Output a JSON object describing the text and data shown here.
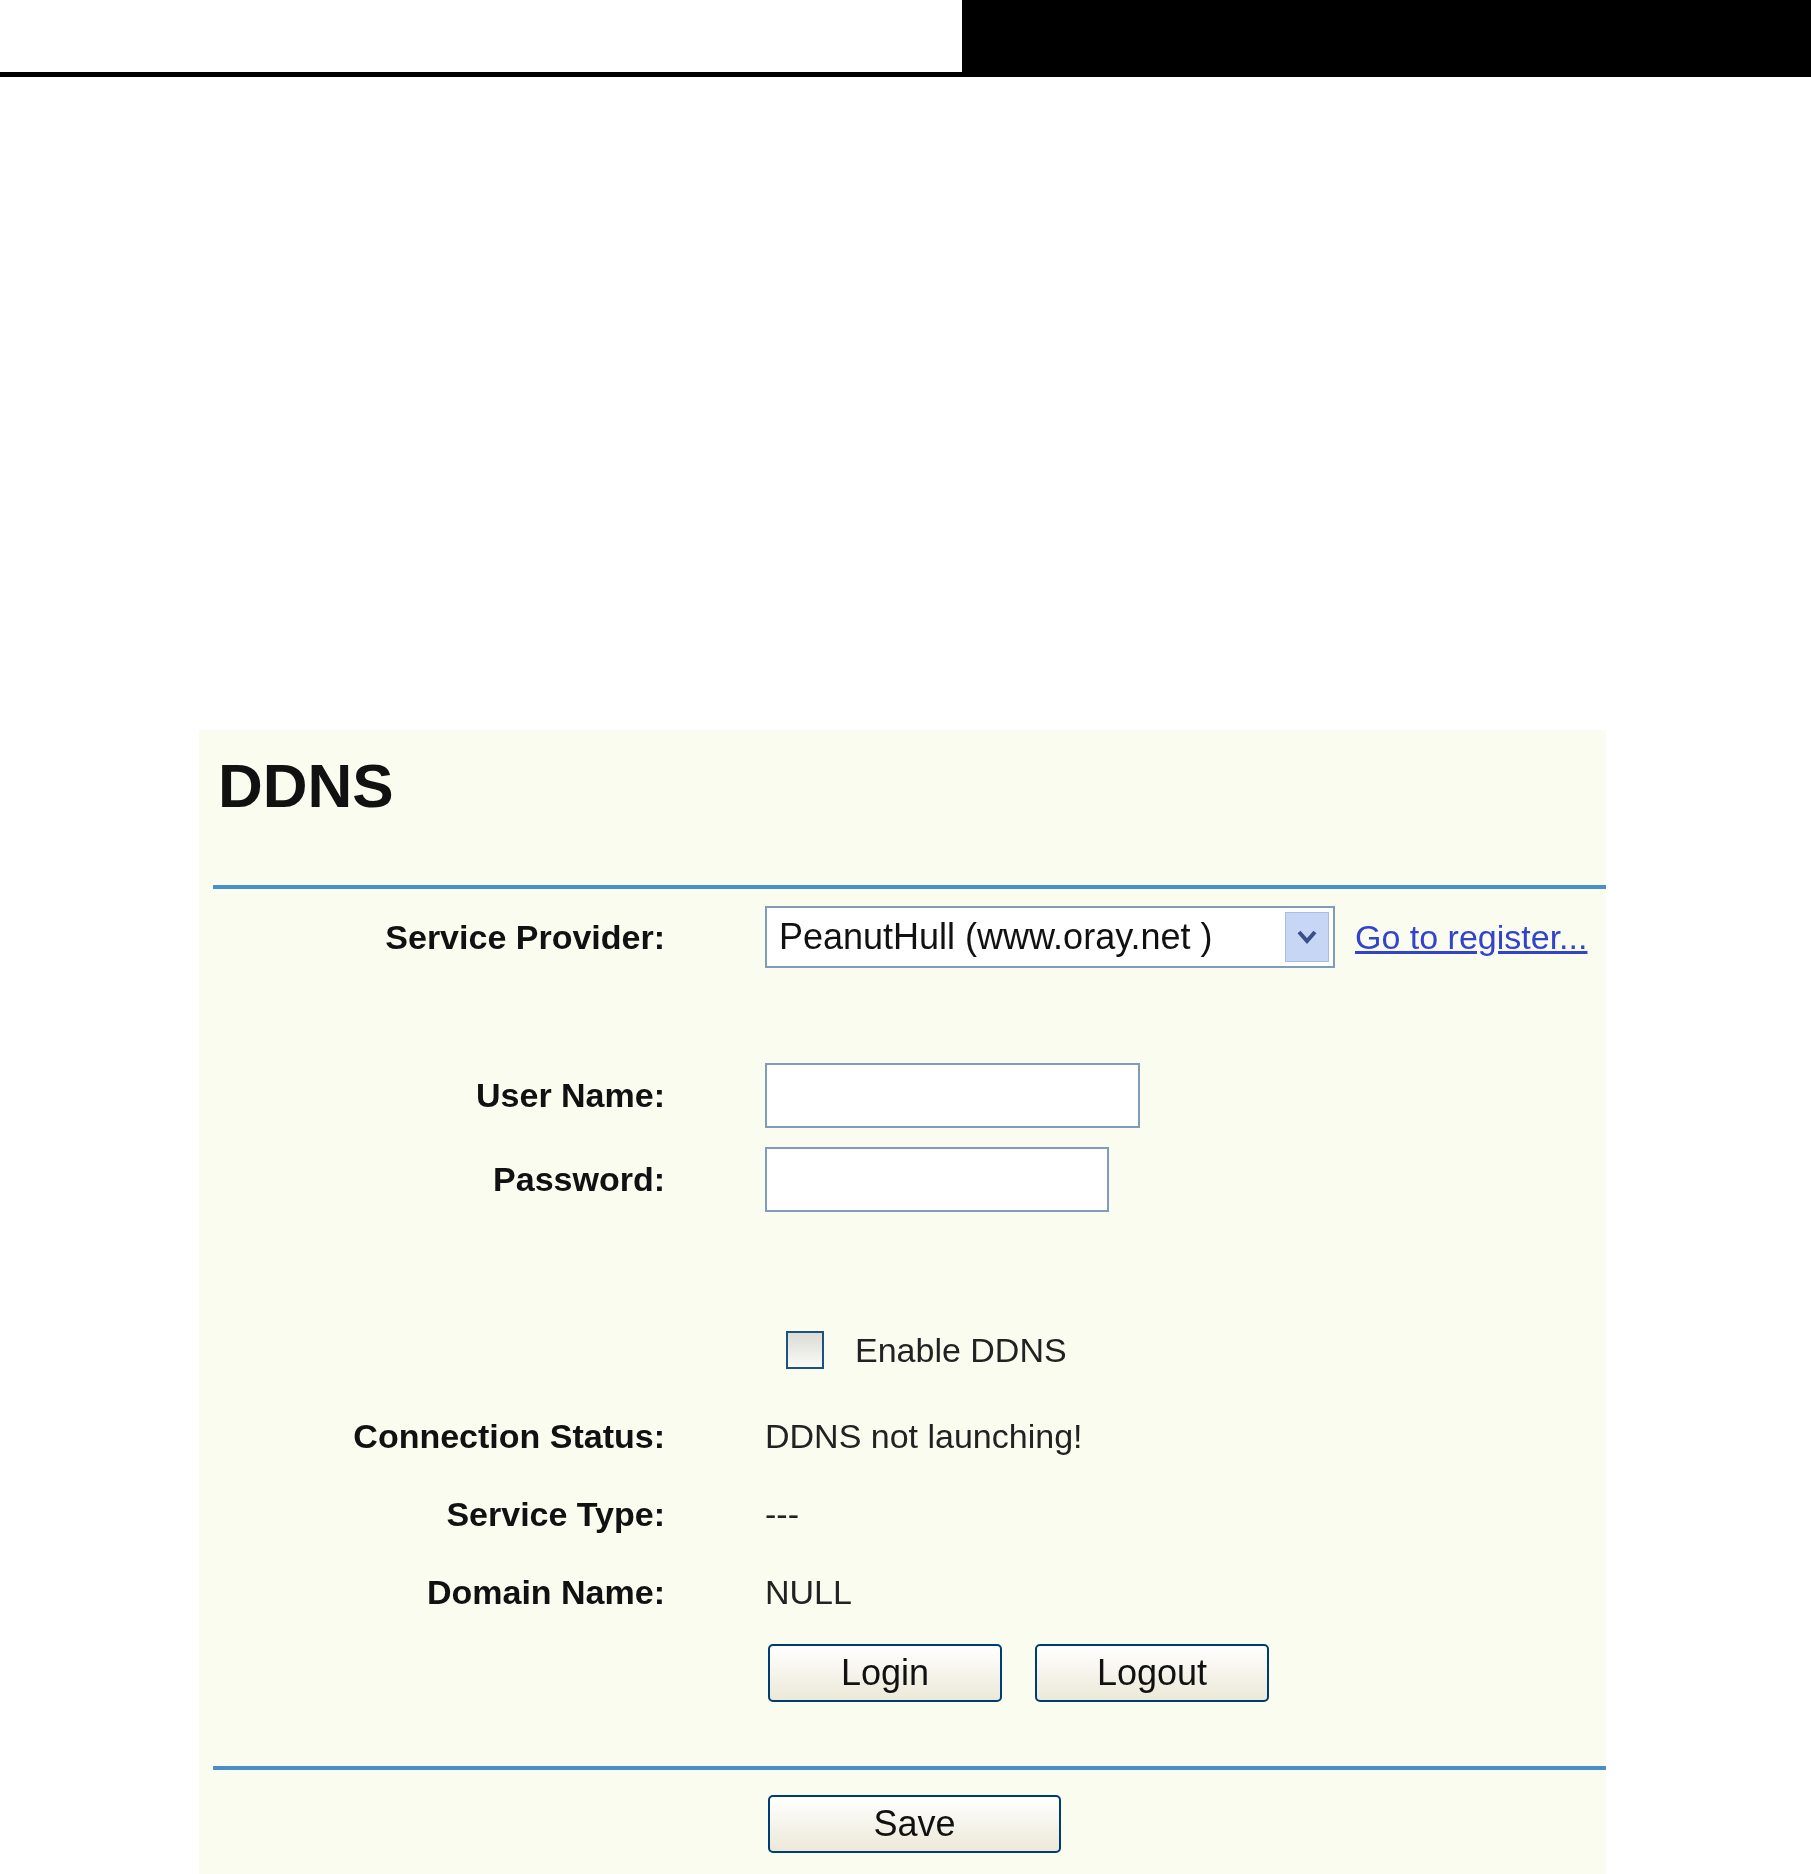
{
  "page_title": "DDNS",
  "service_provider": {
    "label": "Service Provider:",
    "value": "PeanutHull (www.oray.net )",
    "link": "Go to register..."
  },
  "fields": [
    {
      "label": "User Name:",
      "kind": "long"
    },
    {
      "label": "Password:",
      "kind": "short"
    }
  ],
  "enable_ddns": {
    "label": "Enable DDNS",
    "checked": false
  },
  "status": [
    {
      "label": "Connection Status:",
      "value": "DDNS not launching!"
    },
    {
      "label": "Service Type:",
      "value": "---"
    },
    {
      "label": "Domain Name:",
      "value": "NULL"
    }
  ],
  "buttons": [
    "Login",
    "Logout"
  ],
  "save_button": "Save"
}
